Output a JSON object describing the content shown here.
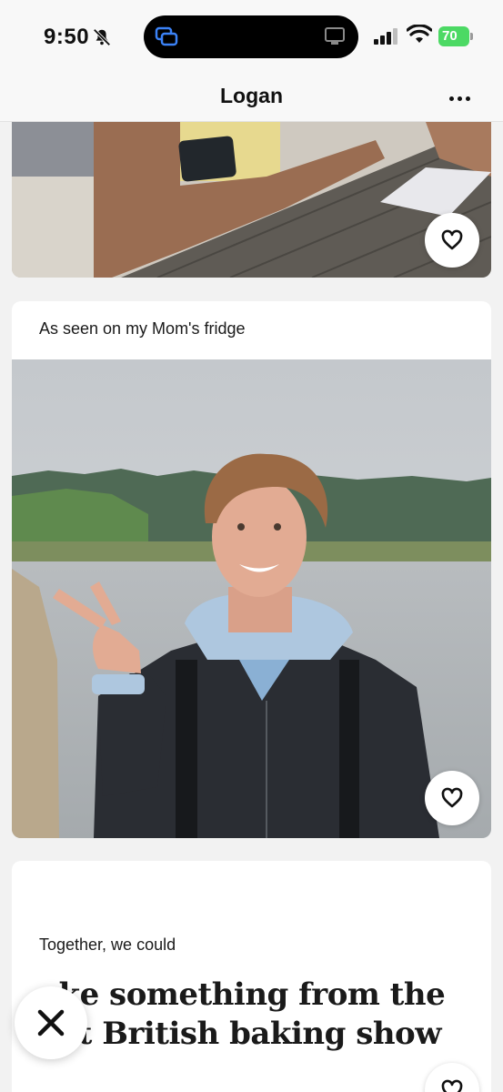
{
  "status_bar": {
    "time": "9:50",
    "battery": "70",
    "icons": [
      "bell-off-icon",
      "screen-share-icon",
      "airplay-icon",
      "signal-icon",
      "wifi-icon",
      "battery-icon"
    ]
  },
  "header": {
    "title": "Logan",
    "more_icon": "more-icon"
  },
  "cards": {
    "prompt_card": {
      "prompt": "As seen on my Mom's fridge"
    },
    "text_card": {
      "label": "Together, we could",
      "answer": "ake something from the eat British baking show"
    }
  },
  "actions": {
    "like_icon": "heart-icon",
    "skip_icon": "close-icon"
  },
  "colors": {
    "background": "#f2f2f2",
    "battery_green": "#4cd964",
    "text": "#111111"
  }
}
